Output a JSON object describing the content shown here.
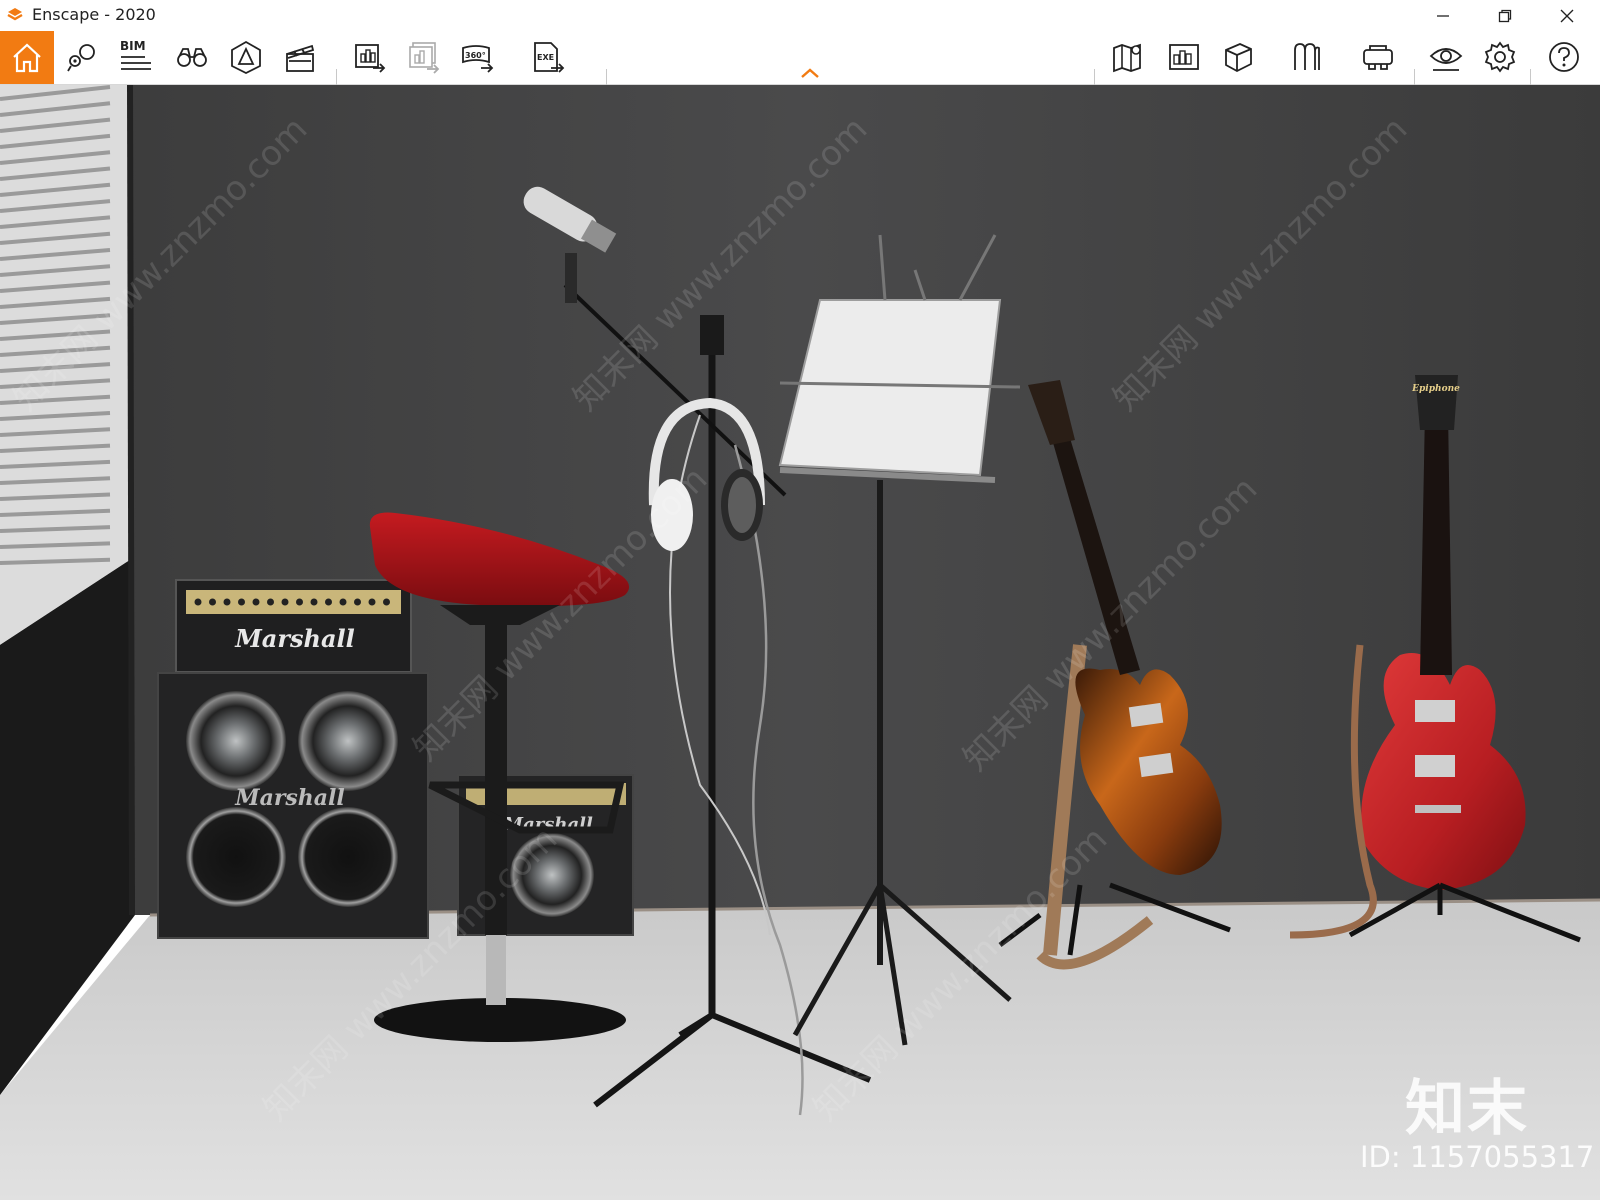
{
  "window": {
    "title": "Enscape - 2020",
    "controls": [
      "minimize",
      "restore",
      "close"
    ]
  },
  "toolbar": {
    "bim_label": "BIM",
    "left_buttons": [
      "home-icon",
      "map-pin-icon",
      "bim-icon",
      "binoculars-icon",
      "safe-frame-icon",
      "clapperboard-icon",
      "render-image-icon",
      "batch-render-icon",
      "panorama-360-icon",
      "export-exe-icon"
    ],
    "panorama_label": "360°",
    "exe_label": "EXE",
    "right_buttons": [
      "map-icon",
      "asset-library-icon",
      "cube-icon",
      "material-icon",
      "vr-headset-icon",
      "visual-settings-icon",
      "settings-gear-icon",
      "help-icon"
    ],
    "collapse_icon": "chevron-up-icon",
    "accent_color": "#f27b12"
  },
  "scene": {
    "amp_brand": "Marshall",
    "small_amp_brand": "Marshall",
    "guitar_brand": "Epiphone"
  },
  "watermark": {
    "logo_text": "知末",
    "id_text": "ID: 1157055317",
    "diagonal_text": "知末网 www.znzmo.com"
  }
}
